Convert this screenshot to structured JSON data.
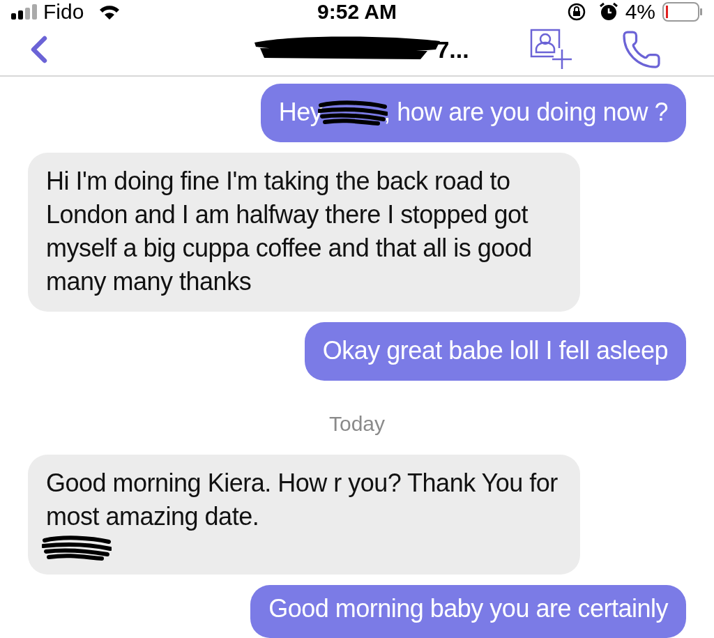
{
  "status_bar": {
    "carrier": "Fido",
    "time": "9:52 AM",
    "battery": "4%"
  },
  "header": {
    "title_visible": "7..."
  },
  "messages": [
    {
      "kind": "sent",
      "parts": [
        {
          "kind": "text",
          "text": "Hey"
        },
        {
          "kind": "redaction"
        },
        {
          "kind": "text",
          "text": ", how are you doing now ?"
        }
      ]
    },
    {
      "kind": "received",
      "parts": [
        {
          "kind": "text",
          "text": "Hi I'm doing fine I'm taking the back road to London and I am halfway there I stopped got myself a big cuppa coffee and that all is good many many thanks"
        }
      ]
    },
    {
      "kind": "sent",
      "parts": [
        {
          "kind": "text",
          "text": "Okay great babe loll I fell asleep"
        }
      ]
    },
    {
      "kind": "date",
      "parts": [
        {
          "kind": "text",
          "text": "Today"
        }
      ]
    },
    {
      "kind": "received",
      "parts": [
        {
          "kind": "text",
          "text": "Good morning Kiera. How r you? Thank You for most amazing date."
        },
        {
          "kind": "redaction"
        }
      ]
    },
    {
      "kind": "sent",
      "parts": [
        {
          "kind": "text",
          "text": "Good morning baby you are certainly"
        }
      ]
    }
  ]
}
